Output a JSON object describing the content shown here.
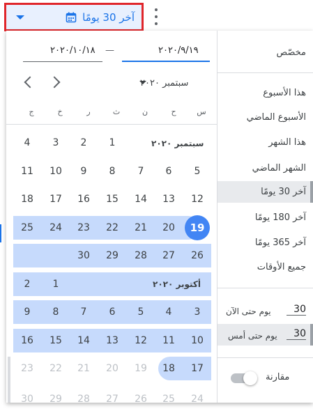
{
  "header": {
    "date_range_label": "آخر 30 يومًا",
    "more_icon": "more-vert-icon",
    "calendar_icon": "calendar-icon"
  },
  "menu": {
    "custom": "مخصّص",
    "items": [
      "هذا الأسبوع",
      "الأسبوع الماضي",
      "هذا الشهر",
      "الشهر الماضي",
      "آخر 30 يومًا",
      "آخر 180 يومًا",
      "آخر 365 يومًا",
      "جميع الأوقات"
    ],
    "selected_index": 4,
    "days_until_today_value": "30",
    "days_until_today_label": "يوم حتى الآن",
    "days_until_yesterday_value": "30",
    "days_until_yesterday_label": "يوم حتى أمس",
    "compare_label": "مقارنة",
    "compare_on": false
  },
  "date_inputs": {
    "start": "٢٠٢٠/٩/١٩",
    "end": "٢٠٢٠/١٠/١٨",
    "separator": "—"
  },
  "calendar": {
    "month_select": "سبتمبر ٢٠٢٠",
    "weekdays": [
      "س",
      "ح",
      "ن",
      "ث",
      "ر",
      "خ",
      "ج"
    ],
    "september_label": "سبتمبر ٢٠٢٠",
    "october_label": "أكتوبر ٢٠٢٠",
    "sep_row1": [
      "1",
      "2",
      "3",
      "4"
    ],
    "sep_row2": [
      "5",
      "6",
      "7",
      "8",
      "9",
      "10",
      "11"
    ],
    "sep_row3": [
      "12",
      "13",
      "14",
      "15",
      "16",
      "17",
      "18"
    ],
    "sep_row4": [
      "19",
      "20",
      "21",
      "22",
      "23",
      "24",
      "25"
    ],
    "sep_row5": [
      "26",
      "27",
      "28",
      "29",
      "30"
    ],
    "oct_row1": [
      "1",
      "2"
    ],
    "oct_row2": [
      "3",
      "4",
      "5",
      "6",
      "7",
      "8",
      "9"
    ],
    "oct_row3": [
      "10",
      "11",
      "12",
      "13",
      "14",
      "15",
      "16"
    ],
    "oct_row4": [
      "17",
      "18",
      "19",
      "20",
      "21",
      "22",
      "23"
    ],
    "oct_row5": [
      "24",
      "25",
      "26",
      "27",
      "28",
      "29",
      "30"
    ],
    "today": "19"
  },
  "colors": {
    "accent": "#1a73e8",
    "highlight_border": "#e0262b",
    "range_band": "#c6dafc",
    "today_circle": "#4285f4"
  }
}
